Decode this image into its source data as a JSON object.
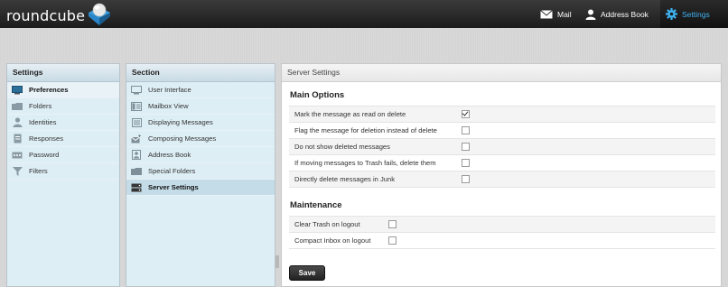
{
  "app": {
    "logo_text": "roundcube"
  },
  "topnav": {
    "mail": "Mail",
    "address_book": "Address Book",
    "settings": "Settings"
  },
  "colors": {
    "accent": "#3fb2f0",
    "panel_bg": "#ddeef5",
    "selected_bg": "#c4dce8"
  },
  "settings_panel": {
    "title": "Settings",
    "items": [
      {
        "label": "Preferences",
        "icon": "monitor-icon",
        "selected": true
      },
      {
        "label": "Folders",
        "icon": "folder-icon"
      },
      {
        "label": "Identities",
        "icon": "person-icon"
      },
      {
        "label": "Responses",
        "icon": "document-icon"
      },
      {
        "label": "Password",
        "icon": "key-field-icon"
      },
      {
        "label": "Filters",
        "icon": "funnel-icon"
      }
    ]
  },
  "section_panel": {
    "title": "Section",
    "items": [
      {
        "label": "User Interface",
        "icon": "monitor-icon"
      },
      {
        "label": "Mailbox View",
        "icon": "mailbox-view-icon"
      },
      {
        "label": "Displaying Messages",
        "icon": "message-display-icon"
      },
      {
        "label": "Composing Messages",
        "icon": "compose-icon"
      },
      {
        "label": "Address Book",
        "icon": "address-book-icon"
      },
      {
        "label": "Special Folders",
        "icon": "folder-icon"
      },
      {
        "label": "Server Settings",
        "icon": "server-icon",
        "selected": true
      }
    ]
  },
  "main": {
    "title": "Server Settings",
    "main_options": {
      "title": "Main Options",
      "rows": [
        {
          "label": "Mark the message as read on delete",
          "checked": true
        },
        {
          "label": "Flag the message for deletion instead of delete",
          "checked": false
        },
        {
          "label": "Do not show deleted messages",
          "checked": false
        },
        {
          "label": "If moving messages to Trash fails, delete them",
          "checked": false
        },
        {
          "label": "Directly delete messages in Junk",
          "checked": false
        }
      ]
    },
    "maintenance": {
      "title": "Maintenance",
      "rows": [
        {
          "label": "Clear Trash on logout",
          "checked": false
        },
        {
          "label": "Compact Inbox on logout",
          "checked": false
        }
      ]
    },
    "save_label": "Save"
  }
}
